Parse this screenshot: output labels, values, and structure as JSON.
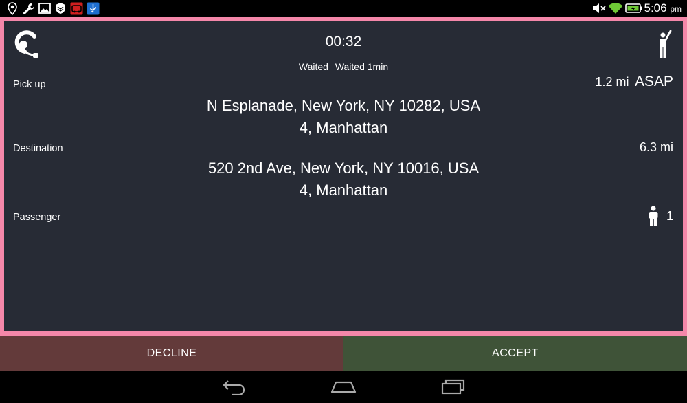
{
  "status_bar": {
    "time": "5:06",
    "ampm": "pm",
    "left_icons": [
      "location-pin-icon",
      "wrench-icon",
      "image-icon",
      "shield-icon",
      "car-app-icon",
      "usb-icon"
    ],
    "right_icons": [
      "mute-icon",
      "wifi-icon",
      "battery-icon"
    ]
  },
  "request": {
    "timer": "00:32",
    "waited_label": "Waited",
    "waited_value": "Waited 1min",
    "pickup": {
      "label": "Pick up",
      "distance": "1.2 mi",
      "when": "ASAP",
      "address_line1": "N Esplanade, New York, NY 10282, USA",
      "address_line2": "4, Manhattan"
    },
    "destination": {
      "label": "Destination",
      "distance": "6.3 mi",
      "address_line1": "520 2nd Ave, New York, NY 10016, USA",
      "address_line2": "4, Manhattan"
    },
    "passenger": {
      "label": "Passenger",
      "count": "1"
    }
  },
  "actions": {
    "decline_label": "DECLINE",
    "accept_label": "ACCEPT"
  },
  "colors": {
    "card_border": "#f487a9",
    "card_background": "#272b35",
    "decline_background": "#633a3a",
    "accept_background": "#3f5338"
  }
}
